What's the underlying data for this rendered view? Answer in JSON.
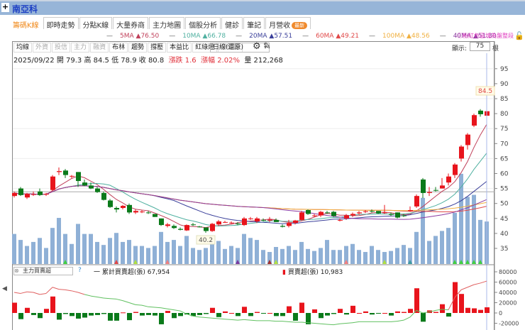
{
  "header": {
    "plus": "+",
    "title": "南亞科"
  },
  "tabs": [
    {
      "label": "籌碼K線",
      "active": true
    },
    {
      "label": "即時走勢"
    },
    {
      "label": "分點K線"
    },
    {
      "label": "大量券商"
    },
    {
      "label": "主力地圖"
    },
    {
      "label": "個股分析"
    },
    {
      "label": "健診"
    },
    {
      "label": "筆記"
    },
    {
      "label": "月營收",
      "badge": "最新"
    }
  ],
  "ma_legend": [
    {
      "name": "5MA",
      "value": "▲76.50",
      "color": "#c0405a",
      "period": 5
    },
    {
      "name": "10MA",
      "value": "▲66.78",
      "color": "#4fb0a0",
      "period": 10
    },
    {
      "name": "20MA",
      "value": "▲57.51",
      "color": "#3a3f9a",
      "period": 20
    },
    {
      "name": "60MA",
      "value": "▲49.21",
      "color": "#e04848",
      "period": 60
    },
    {
      "name": "100MA",
      "value": "▲48.56",
      "color": "#f0b040",
      "period": 100
    },
    {
      "name": "40MA",
      "value": "▲51.30",
      "color": "#8a3aa0",
      "period": 40
    }
  ],
  "note": "ⓘ粉紅色區塊為盤整段",
  "toolbar": [
    {
      "label": "均線"
    },
    {
      "label": "外資",
      "disabled": true
    },
    {
      "label": "投信",
      "disabled": true
    },
    {
      "label": "主力",
      "disabled": true
    },
    {
      "label": "融資",
      "disabled": true
    },
    {
      "label": "布林"
    },
    {
      "label": "趨勢"
    },
    {
      "label": "撐壓"
    },
    {
      "label": "本益比"
    },
    {
      "label": "紅綠燈"
    },
    {
      "label": "分價圖",
      "disabled": true
    }
  ],
  "period_select": "日線(還原)",
  "display": {
    "label": "顯示:",
    "value": "75",
    "unit": "根"
  },
  "info": {
    "date": "2025/09/22",
    "open_label": "開",
    "open": "79.3",
    "high_label": "高",
    "high": "84.5",
    "low_label": "低",
    "low": "78.9",
    "close_label": "收",
    "close": "80.8",
    "change": "漲跌 1.6",
    "change_pct": "漲幅 2.02%",
    "volume_label": "量",
    "volume": "212,268"
  },
  "indicator": {
    "select": "主力買賣超",
    "help": "?",
    "cum_label": "一 累計買賣超(張) 67,954",
    "net_label": "買賣超(張) 10,983"
  },
  "colors": {
    "up": "#e8141c",
    "down": "#0a7a1a",
    "volume": "#8fb0d6",
    "accent": "#1c3fc4"
  },
  "chart_data": {
    "type": "candlestick",
    "price_axis": {
      "ticks": [
        35,
        40,
        45,
        50,
        55,
        60,
        65,
        70,
        75,
        80,
        85,
        90,
        95
      ]
    },
    "high_marker": "84.5",
    "low_marker": "40.2",
    "reference_price": 53.9,
    "ohlc": [
      [
        52.5,
        54,
        52,
        53.5
      ],
      [
        55,
        55.5,
        52.5,
        52.8
      ],
      [
        52,
        53.5,
        51.5,
        53.2
      ],
      [
        53,
        54,
        52.5,
        53.1
      ],
      [
        54,
        55,
        52.5,
        52.8
      ],
      [
        53,
        53.5,
        52.5,
        53.2
      ],
      [
        54.5,
        59.5,
        54.3,
        59
      ],
      [
        60.5,
        62,
        59.5,
        60.8
      ],
      [
        61,
        61.5,
        58.5,
        59.5
      ],
      [
        59,
        59.5,
        58.5,
        59.2
      ],
      [
        60.5,
        60.5,
        55.5,
        57.5
      ],
      [
        57,
        58,
        55.8,
        56
      ],
      [
        56,
        57,
        54.8,
        55
      ],
      [
        55,
        55.5,
        53.5,
        53.8
      ],
      [
        53.5,
        54,
        51,
        51.2
      ],
      [
        51,
        51.5,
        48.5,
        48.8
      ],
      [
        48.5,
        49,
        47,
        48
      ],
      [
        48.5,
        49.5,
        48,
        49.2
      ],
      [
        49.5,
        50,
        46.5,
        47
      ],
      [
        47,
        48,
        46.5,
        47.5
      ],
      [
        47.3,
        47.8,
        46.8,
        47.3
      ],
      [
        47,
        47.5,
        46.5,
        46.8
      ],
      [
        46.5,
        46.5,
        45.5,
        45.5
      ],
      [
        45,
        45,
        42.5,
        42.8
      ],
      [
        42.5,
        43.5,
        42,
        43
      ],
      [
        42.5,
        43,
        41.5,
        41.8
      ],
      [
        41.5,
        42,
        41,
        41.2
      ],
      [
        41,
        43,
        40.8,
        42.8
      ],
      [
        43,
        43.5,
        42.5,
        42.8
      ],
      [
        42.3,
        42.5,
        42,
        42.2
      ],
      [
        42,
        42,
        40.2,
        40.8
      ],
      [
        40.8,
        43.5,
        40.5,
        43.2
      ],
      [
        43,
        44.5,
        42.5,
        44
      ],
      [
        43.8,
        44.2,
        43.5,
        43.8
      ],
      [
        43.5,
        44,
        43.2,
        43.6
      ],
      [
        43.3,
        43.8,
        42.8,
        43.2
      ],
      [
        42.8,
        45.5,
        42.5,
        45
      ],
      [
        45,
        45.5,
        44.5,
        45
      ],
      [
        44,
        45.5,
        43.5,
        45
      ],
      [
        44.5,
        45,
        44,
        44.3
      ],
      [
        44.3,
        45.5,
        43.8,
        44.6
      ],
      [
        44.5,
        45,
        43.8,
        43.8
      ],
      [
        42.5,
        43,
        42,
        42.2
      ],
      [
        42.5,
        44.5,
        42,
        43.5
      ],
      [
        43.5,
        44.5,
        43,
        44.3
      ],
      [
        44.5,
        47.5,
        44.3,
        47
      ],
      [
        47.8,
        48,
        46.2,
        46.5
      ],
      [
        46,
        46.5,
        45.5,
        46
      ],
      [
        46,
        47.5,
        45.5,
        47.2
      ],
      [
        47,
        47.5,
        46.5,
        46.8
      ],
      [
        47.2,
        47.5,
        45.5,
        45.8
      ],
      [
        44.5,
        45,
        44,
        44.5
      ],
      [
        45,
        46.5,
        44.5,
        46
      ],
      [
        46,
        47,
        45.5,
        46.5
      ],
      [
        46.7,
        47.5,
        46.2,
        47
      ],
      [
        47.2,
        47.8,
        46.8,
        47.4
      ],
      [
        47.5,
        48,
        47,
        47.3
      ],
      [
        47.5,
        47.5,
        46.5,
        46.7
      ],
      [
        46.8,
        49.5,
        46.5,
        47
      ],
      [
        46.5,
        47,
        45.8,
        46.2
      ],
      [
        47,
        47,
        45,
        45.3
      ],
      [
        46,
        46.5,
        45.5,
        45.8
      ],
      [
        47.5,
        49,
        47.2,
        47.8
      ],
      [
        49,
        53,
        48.5,
        52.5
      ],
      [
        58,
        58.5,
        51.8,
        53.5
      ],
      [
        53.5,
        55.5,
        52.5,
        53.8
      ],
      [
        54.5,
        55.5,
        54,
        54.4
      ],
      [
        55,
        58.5,
        55,
        56
      ],
      [
        57,
        60,
        56,
        59
      ],
      [
        59.5,
        63.5,
        58.5,
        63
      ],
      [
        65,
        69.5,
        64,
        69
      ],
      [
        69.5,
        73.5,
        68,
        73
      ],
      [
        76,
        80,
        75.5,
        79.5
      ],
      [
        81,
        81.5,
        79,
        79.8
      ],
      [
        79.3,
        84.5,
        78.9,
        80.8
      ]
    ],
    "volume": [
      150,
      120,
      90,
      110,
      130,
      80,
      180,
      230,
      150,
      100,
      200,
      150,
      150,
      110,
      95,
      130,
      155,
      110,
      120,
      90,
      90,
      80,
      90,
      160,
      110,
      120,
      90,
      140,
      80,
      70,
      80,
      115,
      115,
      75,
      90,
      80,
      150,
      130,
      120,
      70,
      60,
      85,
      75,
      90,
      70,
      110,
      75,
      65,
      80,
      120,
      70,
      70,
      90,
      100,
      70,
      60,
      90,
      70,
      60,
      65,
      80,
      95,
      80,
      160,
      330,
      115,
      140,
      165,
      180,
      255,
      450,
      335,
      345,
      220,
      212
    ],
    "signal_markers": [
      {
        "i": 8,
        "color": "#40d040"
      },
      {
        "i": 16,
        "color": "#e04848"
      },
      {
        "i": 19,
        "color": "#b0e040"
      },
      {
        "i": 24,
        "color": "#f08080"
      },
      {
        "i": 35,
        "color": "#7a3aa0"
      },
      {
        "i": 40,
        "color": "#a03030"
      },
      {
        "i": 41,
        "color": "#b0e040"
      },
      {
        "i": 52,
        "color": "#f08080"
      },
      {
        "i": 58,
        "color": "#b0e040"
      },
      {
        "i": 62,
        "color": "#3a9aa0"
      },
      {
        "i": 69,
        "color": "#40d040"
      },
      {
        "i": 70,
        "color": "#40d040"
      },
      {
        "i": 71,
        "color": "#40d040"
      },
      {
        "i": 72,
        "color": "#40d040"
      },
      {
        "i": 73,
        "color": "#40d040"
      }
    ],
    "indicator_axis": {
      "ticks": [
        80000,
        60000,
        40000,
        20000,
        0,
        -20000
      ]
    },
    "net_buy_sell": [
      20,
      -12,
      10,
      -4,
      -10,
      8,
      32,
      -13,
      -2,
      -6,
      -11,
      -9,
      -5,
      -4,
      -2,
      -15,
      -15,
      1,
      -14,
      2,
      -5,
      -4,
      -5,
      -22,
      4,
      -10,
      -6,
      -3,
      -6,
      -4,
      -2,
      10,
      -8,
      3,
      0,
      -6,
      12,
      -6,
      2,
      -1,
      0,
      -6,
      -6,
      13,
      -15,
      20,
      -22,
      7,
      -10,
      -5,
      -2,
      8,
      -3,
      14,
      0,
      3,
      -3,
      -1,
      0,
      -5,
      3,
      2,
      8,
      48,
      -17,
      5,
      2,
      17,
      -7,
      60,
      37,
      10,
      9,
      6,
      11
    ],
    "cumulative": [
      40,
      38,
      41,
      40,
      36,
      38,
      50,
      46,
      45,
      43,
      40,
      36,
      33,
      31,
      29,
      28,
      27,
      24,
      20,
      16,
      15,
      12,
      11,
      10,
      8,
      6,
      4,
      -2,
      -6,
      -8,
      -9,
      -10,
      -11,
      -12,
      -13,
      -14,
      -13,
      -14,
      -15,
      -15,
      -15,
      -16,
      -16,
      -17,
      -18,
      -18,
      -19,
      -20,
      -21,
      -22,
      -23,
      -21,
      -20,
      -19,
      -17,
      -17,
      -17,
      -17,
      -17,
      -17,
      -16,
      -14,
      -8,
      5,
      0,
      2,
      5,
      7,
      6,
      30,
      45,
      50,
      55,
      58,
      62
    ],
    "value_unit": "thousand 張"
  }
}
